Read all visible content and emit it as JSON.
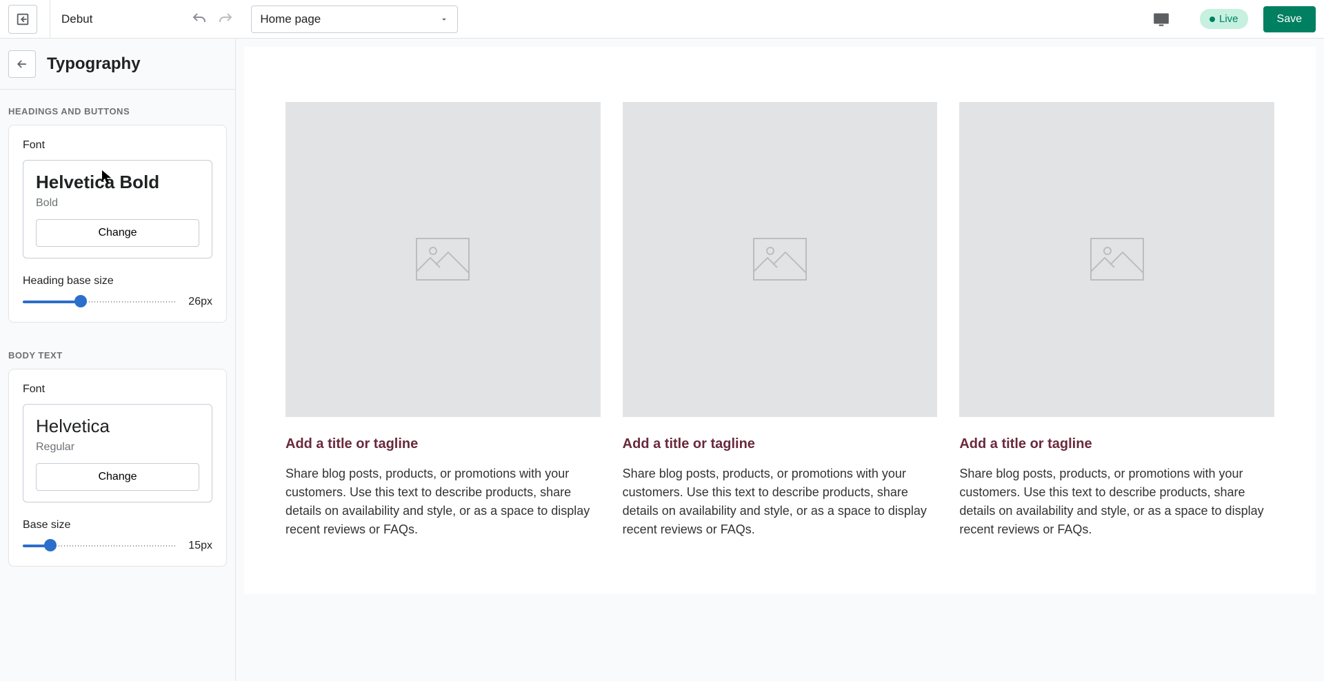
{
  "topbar": {
    "theme_name": "Debut",
    "page_select": "Home page",
    "live_label": "Live",
    "save_label": "Save"
  },
  "sidebar": {
    "title": "Typography",
    "heading_section": {
      "label": "HEADINGS AND BUTTONS",
      "font_label": "Font",
      "font_name": "Helvetica Bold",
      "font_weight": "Bold",
      "change_label": "Change",
      "size_label": "Heading base size",
      "size_value": "26px",
      "slider_percent": 38
    },
    "body_section": {
      "label": "BODY TEXT",
      "font_label": "Font",
      "font_name": "Helvetica",
      "font_weight": "Regular",
      "change_label": "Change",
      "size_label": "Base size",
      "size_value": "15px",
      "slider_percent": 18
    }
  },
  "preview": {
    "columns": [
      {
        "title": "Add a title or tagline",
        "text": "Share blog posts, products, or promotions with your customers. Use this text to describe products, share details on availability and style, or as a space to display recent reviews or FAQs."
      },
      {
        "title": "Add a title or tagline",
        "text": "Share blog posts, products, or promotions with your customers. Use this text to describe products, share details on availability and style, or as a space to display recent reviews or FAQs."
      },
      {
        "title": "Add a title or tagline",
        "text": "Share blog posts, products, or promotions with your customers. Use this text to describe products, share details on availability and style, or as a space to display recent reviews or FAQs."
      }
    ]
  }
}
